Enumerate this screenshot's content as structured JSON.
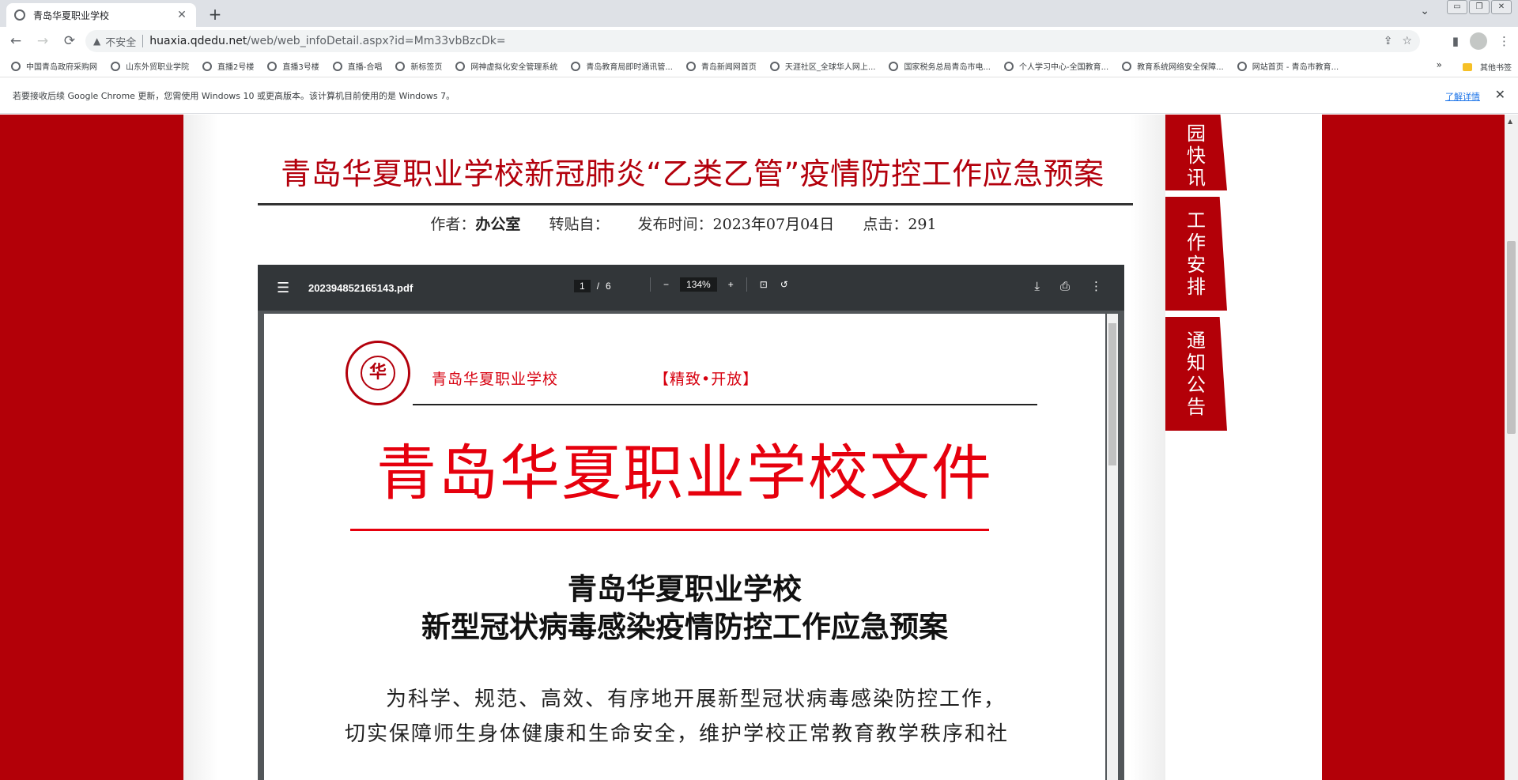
{
  "browser": {
    "tab_title": "青岛华夏职业学校",
    "tab_close": "✕",
    "new_tab": "+",
    "tab_search": "⌄",
    "window_controls": [
      "▭",
      "❐",
      "✕"
    ],
    "security_label": "不安全",
    "url_host": "huaxia.qdedu.net",
    "url_path": "/web/web_infoDetail.aspx?id=Mm33vbBzcDk=",
    "nav": {
      "back": "←",
      "forward": "→",
      "reload": "⟳"
    },
    "omni_icons": {
      "share": "⇪",
      "star": "☆"
    },
    "toolbar_icons": {
      "sidepanel": "▮",
      "menu": "⋮"
    }
  },
  "bookmarks": {
    "items": [
      "中国青岛政府采购网",
      "山东外贸职业学院",
      "直播2号楼",
      "直播3号楼",
      "直播-合唱",
      "新标签页",
      "网神虚拟化安全管理系统",
      "青岛教育局即时通讯管...",
      "青岛新闻网首页",
      "天涯社区_全球华人网上...",
      "国家税务总局青岛市电...",
      "个人学习中心-全国教育...",
      "教育系统网络安全保障...",
      "网站首页 - 青岛市教育..."
    ],
    "more": "»",
    "other": "其他书签"
  },
  "infobar": {
    "message": "若要接收后续 Google Chrome 更新，您需使用 Windows 10 或更高版本。该计算机目前使用的是 Windows 7。",
    "learn_more": "了解详情",
    "close": "✕"
  },
  "article": {
    "title": "青岛华夏职业学校新冠肺炎“乙类乙管”疫情防控工作应急预案",
    "author_label": "作者：",
    "author": "办公室",
    "repost_label": "转贴自：",
    "repost": "",
    "date_label": "发布时间：",
    "date": "2023年07月04日",
    "clicks_label": "点击：",
    "clicks": "291"
  },
  "side_tabs": [
    {
      "chars": [
        "园",
        "快",
        "讯"
      ]
    },
    {
      "chars": [
        "工",
        "作",
        "安",
        "排"
      ]
    },
    {
      "chars": [
        "通",
        "知",
        "公",
        "告"
      ]
    }
  ],
  "pdf": {
    "menu_icon": "☰",
    "filename": "202394852165143.pdf",
    "page_current": "1",
    "page_sep": "/",
    "page_total": "6",
    "zoom_out": "−",
    "zoom": "134%",
    "zoom_in": "+",
    "fit_icon": "⊡",
    "rotate_icon": "↺",
    "download_icon": "⤓",
    "print_icon": "⎙",
    "more_icon": "⋮",
    "page": {
      "seal_text": "华",
      "school_name": "青岛华夏职业学校",
      "motto": "【精致•开放】",
      "doc_header": "青岛华夏职业学校文件",
      "title_line1": "青岛华夏职业学校",
      "title_line2": "新型冠状病毒感染疫情防控工作应急预案",
      "para_line1": "为科学、规范、高效、有序地开展新型冠状病毒感染防控工作，",
      "para_line2": "切实保障师生身体健康和生命安全，维护学校正常教育教学秩序和社"
    }
  },
  "colors": {
    "brand_red": "#b30008",
    "title_red": "#b3000c",
    "doc_red": "#e6000d"
  }
}
